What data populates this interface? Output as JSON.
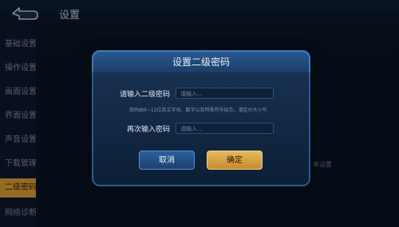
{
  "app": {
    "title": "设置"
  },
  "sidebar": {
    "items": [
      {
        "label": "基础设置"
      },
      {
        "label": "操作设置"
      },
      {
        "label": "画面设置"
      },
      {
        "label": "界面设置"
      },
      {
        "label": "声音设置"
      },
      {
        "label": "下载管理"
      },
      {
        "label": "二级密码"
      },
      {
        "label": "网络诊断"
      }
    ]
  },
  "background": {
    "status_text": "未设置"
  },
  "dialog": {
    "title": "设置二级密码",
    "field1_label": "请输入二级密码",
    "field1_placeholder": "请输入...",
    "hint": "密码由6~12位英文字母、数字以及特殊符号组合，请区分大小写",
    "field2_label": "再次输入密码",
    "field2_placeholder": "请输入...",
    "cancel_label": "取消",
    "confirm_label": "确定"
  }
}
